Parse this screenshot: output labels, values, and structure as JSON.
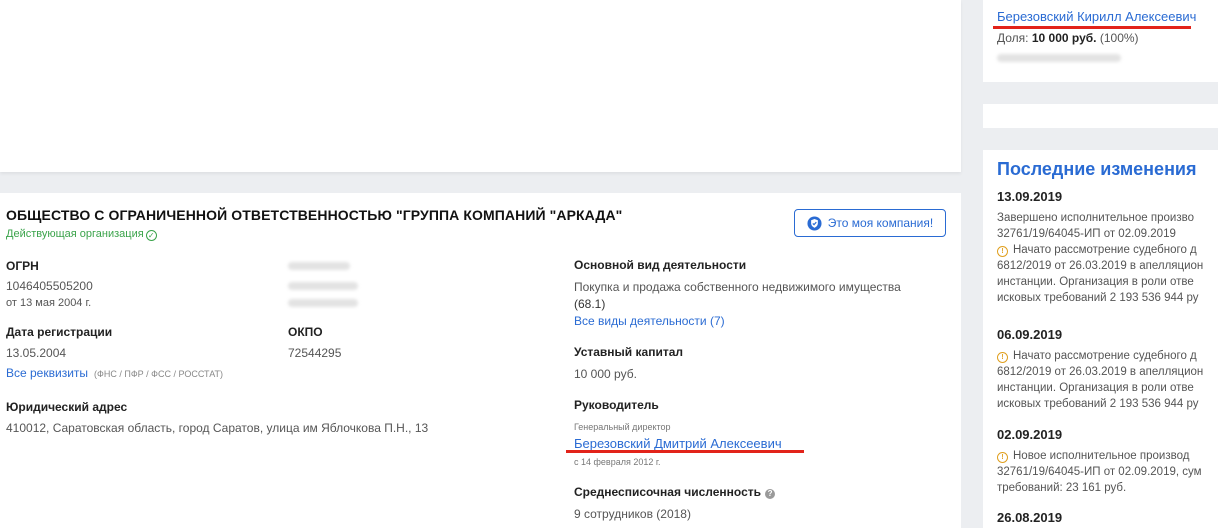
{
  "company": {
    "title": "ОБЩЕСТВО С ОГРАНИЧЕННОЙ ОТВЕТСТВЕННОСТЬЮ \"ГРУППА КОМПАНИЙ \"АРКАДА\"",
    "status": "Действующая организация",
    "mine_button": "Это моя компания!"
  },
  "details": {
    "ogrn_label": "ОГРН",
    "ogrn_value": "1046405505200",
    "ogrn_date": "от 13 мая 2004 г.",
    "reg_label": "Дата регистрации",
    "reg_value": "13.05.2004",
    "okpo_label": "ОКПО",
    "okpo_value": "72544295",
    "requisites_link": "Все реквизиты",
    "requisites_note": "(ФНС / ПФР / ФСС / РОССТАТ)",
    "address_label": "Юридический адрес",
    "address_value": "410012, Саратовская область, город Саратов, улица им Яблочкова П.Н., 13"
  },
  "activity": {
    "label": "Основной вид деятельности",
    "value": "Покупка и продажа собственного недвижимого имущества",
    "code": "(68.1)",
    "all_link": "Все виды деятельности (7)"
  },
  "capital": {
    "label": "Уставный капитал",
    "value": "10 000 руб."
  },
  "director": {
    "label": "Руководитель",
    "position": "Генеральный директор",
    "name": "Березовский Дмитрий Алексеевич",
    "since": "с 14 февраля 2012 г."
  },
  "staff": {
    "label": "Среднесписочная численность",
    "value": "9 сотрудников (2018)"
  },
  "owner": {
    "name": "Березовский Кирилл Алексеевич",
    "share_prefix": "Доля:",
    "share_amount": "10 000 руб.",
    "share_percent": "(100%)"
  },
  "changes": {
    "title": "Последние изменения",
    "entries": [
      {
        "date": "13.09.2019",
        "lines": [
          "Завершено исполнительное произво",
          "32761/19/64045-ИП от 02.09.2019"
        ],
        "warn_lines": [
          "Начато рассмотрение судебного д",
          "6812/2019 от 26.03.2019 в апелляцион",
          "инстанции. Организация в роли отве",
          "исковых требований 2 193 536 944 ру"
        ]
      },
      {
        "date": "06.09.2019",
        "warn_lines": [
          "Начато рассмотрение судебного д",
          "6812/2019 от 26.03.2019 в апелляцион",
          "инстанции. Организация в роли отве",
          "исковых требований 2 193 536 944 ру"
        ]
      },
      {
        "date": "02.09.2019",
        "warn_lines": [
          "Новое исполнительное производ",
          "32761/19/64045-ИП от 02.09.2019, сум",
          "требований: 23 161 руб."
        ]
      },
      {
        "date": "26.08.2019"
      }
    ]
  },
  "colors": {
    "link": "#2a6bd3",
    "status_green": "#3aa34a",
    "underline_red": "#e2231a",
    "warning": "#e0a020"
  }
}
